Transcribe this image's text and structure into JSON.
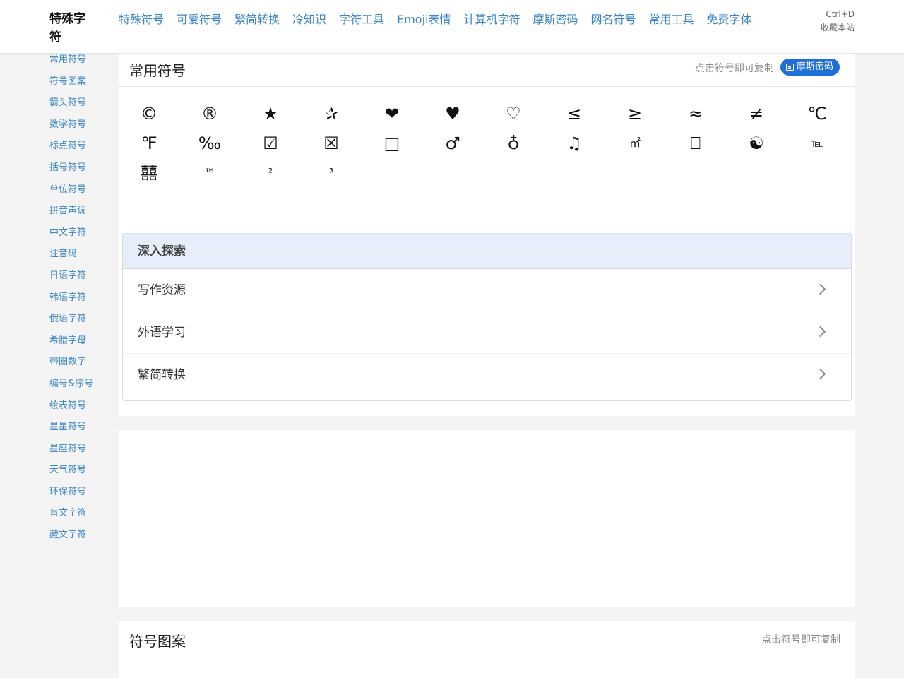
{
  "brand": {
    "name_line1": "特殊字",
    "name_line2": "符"
  },
  "topnav": [
    "特殊符号",
    "可爱符号",
    "繁简转换",
    "冷知识",
    "字符工具",
    "Emoji表情",
    "计算机字符",
    "摩斯密码",
    "网名符号",
    "常用工具",
    "免费字体"
  ],
  "bookmark": {
    "shortcut": "Ctrl+D",
    "label": "收藏本站"
  },
  "sidebar": [
    "常用符号",
    "符号图案",
    "箭头符号",
    "数学符号",
    "标点符号",
    "括号符号",
    "单位符号",
    "拼音声调",
    "中文字符",
    "注音码",
    "日语字符",
    "韩语字符",
    "俄语字符",
    "希腊字母",
    "带圈数字",
    "编号&序号",
    "绘表符号",
    "星星符号",
    "星座符号",
    "天气符号",
    "环保符号",
    "盲文字符",
    "藏文字符"
  ],
  "common_panel": {
    "title": "常用符号",
    "hint": "点击符号即可复制",
    "morse_button": "摩斯密码",
    "symbols": [
      "©",
      "®",
      "★",
      "✰",
      "❤",
      "♥",
      "♡",
      "≤",
      "≥",
      "≈",
      "≠",
      "℃",
      "℉",
      "‰",
      "☑",
      "☒",
      "□",
      "♂",
      "♁",
      "♫",
      "㎡",
      "⎕",
      "☯",
      "℡",
      "囍",
      "™",
      "²",
      "³"
    ]
  },
  "explore": {
    "title": "深入探索",
    "items": [
      "写作资源",
      "外语学习",
      "繁简转换"
    ]
  },
  "pattern_panel": {
    "title": "符号图案",
    "hint": "点击符号即可复制"
  },
  "icons": {
    "chevron": "chevron-right-icon",
    "morse": "book-icon"
  },
  "colors": {
    "link": "#3a84c7",
    "button": "#1f6fd6",
    "explore_head": "#e6eef9"
  }
}
